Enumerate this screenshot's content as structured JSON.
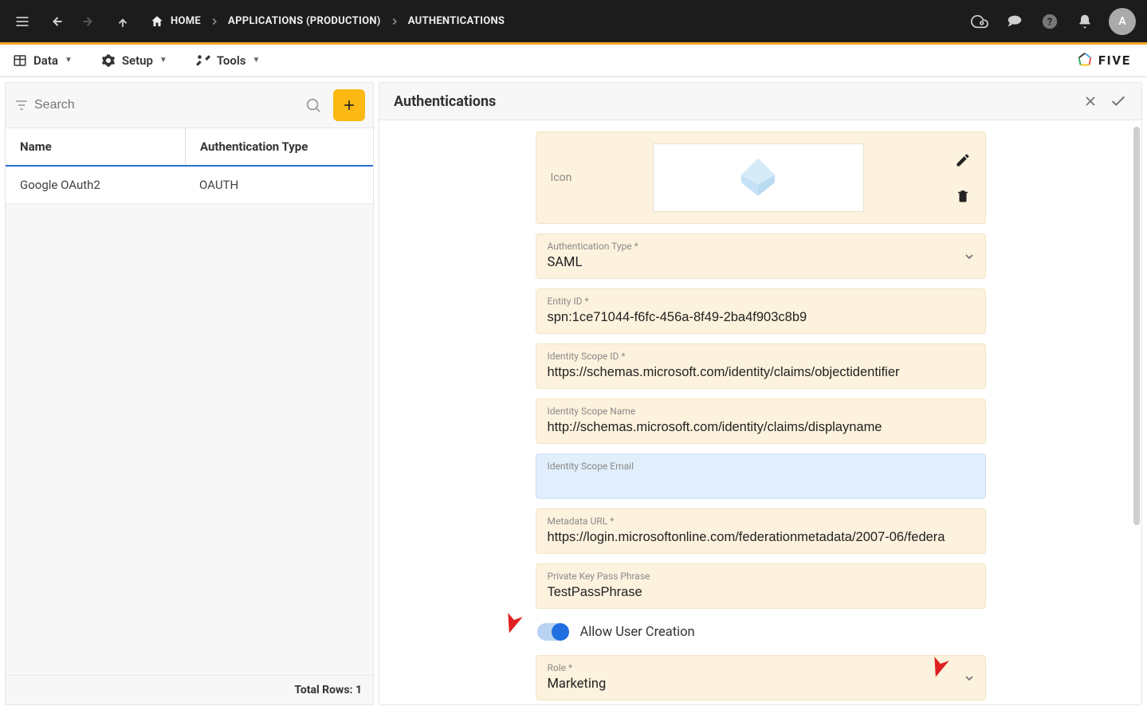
{
  "topbar": {
    "breadcrumbs": [
      {
        "icon": "home",
        "label": "HOME"
      },
      {
        "label": "APPLICATIONS (PRODUCTION)"
      },
      {
        "label": "AUTHENTICATIONS"
      }
    ],
    "avatar_initial": "A"
  },
  "menubar": {
    "items": [
      {
        "icon": "table",
        "label": "Data"
      },
      {
        "icon": "gear",
        "label": "Setup"
      },
      {
        "icon": "tools",
        "label": "Tools"
      }
    ],
    "brand": "FIVE"
  },
  "sidebar": {
    "search_placeholder": "Search",
    "columns": {
      "name": "Name",
      "type": "Authentication Type"
    },
    "rows": [
      {
        "name": "Google OAuth2",
        "type": "OAUTH"
      }
    ],
    "footer_label": "Total Rows:",
    "footer_count": "1"
  },
  "content": {
    "title": "Authentications",
    "fields": {
      "icon_label": "Icon",
      "auth_type": {
        "label": "Authentication Type *",
        "value": "SAML"
      },
      "entity_id": {
        "label": "Entity ID *",
        "value": "spn:1ce71044-f6fc-456a-8f49-2ba4f903c8b9"
      },
      "scope_id": {
        "label": "Identity Scope ID *",
        "value": "https://schemas.microsoft.com/identity/claims/objectidentifier"
      },
      "scope_name": {
        "label": "Identity Scope Name",
        "value": "http://schemas.microsoft.com/identity/claims/displayname"
      },
      "scope_email": {
        "label": "Identity Scope Email",
        "value": ""
      },
      "metadata_url": {
        "label": "Metadata URL *",
        "value": "https://login.microsoftonline.com/federationmetadata/2007-06/federa"
      },
      "passphrase": {
        "label": "Private Key Pass Phrase",
        "value": "TestPassPhrase"
      },
      "allow_user_creation": {
        "label": "Allow User Creation",
        "value": true
      },
      "role": {
        "label": "Role *",
        "value": "Marketing"
      }
    }
  }
}
